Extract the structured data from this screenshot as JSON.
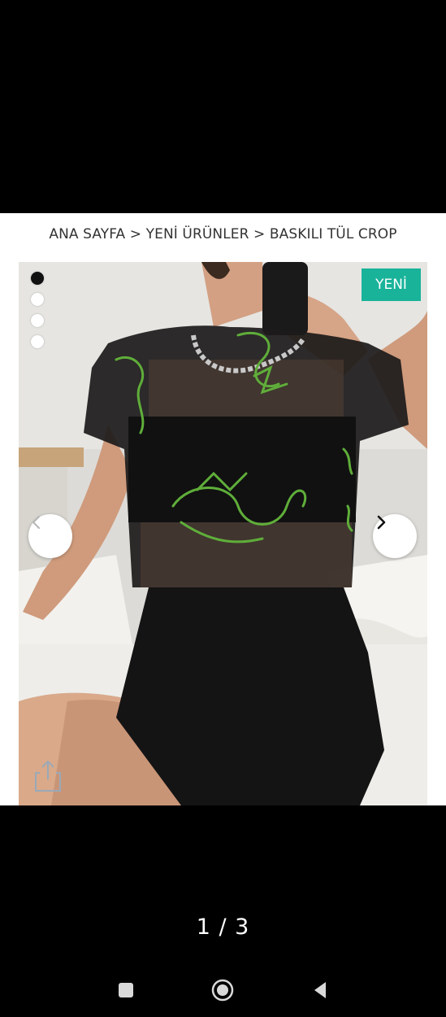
{
  "breadcrumb": {
    "text": "ANA SAYFA > YENİ ÜRÜNLER > BASKILI TÜL CROP"
  },
  "gallery": {
    "badge": "YENİ",
    "image": "product-photo: woman in black mesh crop top with green dragon print and black ribbed skirt",
    "total_dots": 4,
    "active_dot": 1,
    "prev_icon": "chevron-left-icon",
    "next_icon": "chevron-right-icon",
    "share_icon": "share-icon"
  },
  "viewer": {
    "counter": "1 / 3"
  },
  "system_nav": {
    "recents_icon": "square-icon",
    "home_icon": "circle-icon",
    "back_icon": "triangle-back-icon"
  },
  "colors": {
    "badge": "#19b39a",
    "background": "#000000",
    "dragon_print": "#5fae3a"
  }
}
